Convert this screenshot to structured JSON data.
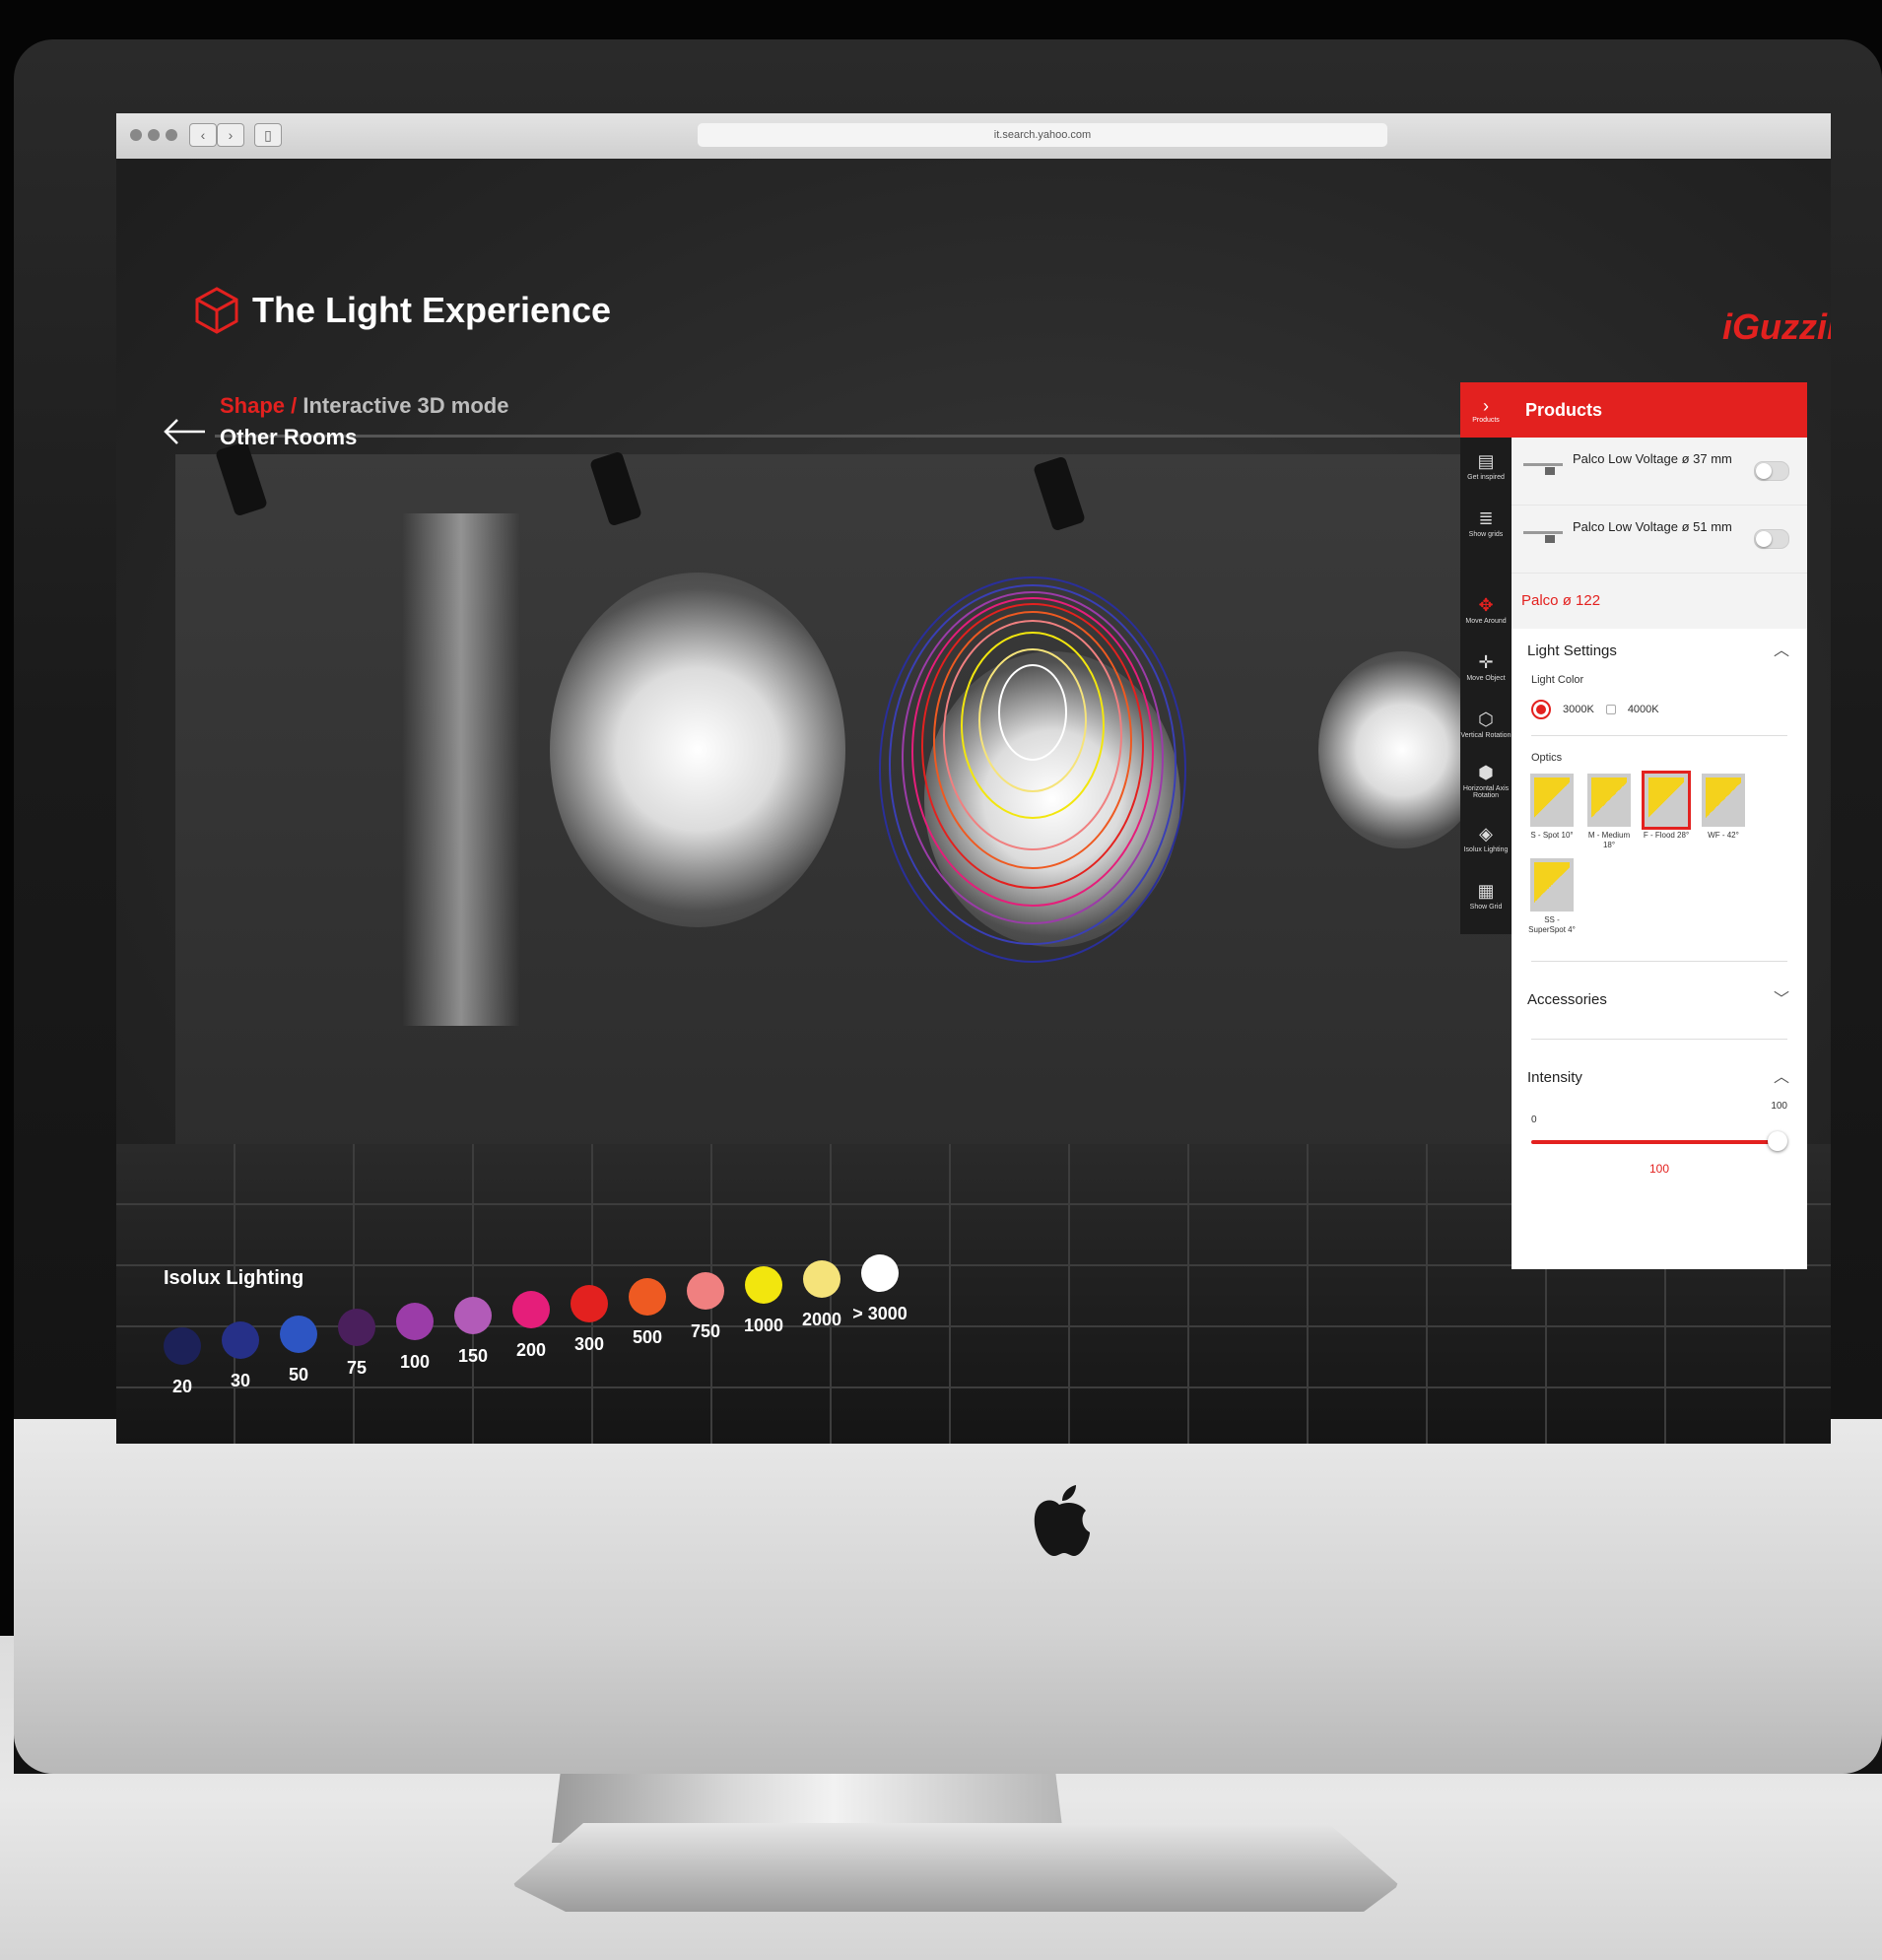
{
  "browser": {
    "url": "it.search.yahoo.com"
  },
  "header": {
    "title": "The Light Experience",
    "brand": "iGuzzini",
    "breadcrumb_section": "Shape /",
    "breadcrumb_mode": "Interactive 3D mode",
    "back_label": "Other Rooms"
  },
  "isolux": {
    "title": "Isolux Lighting",
    "legend": [
      {
        "label": "20",
        "color": "#1c2158"
      },
      {
        "label": "30",
        "color": "#263088"
      },
      {
        "label": "50",
        "color": "#2d55c3"
      },
      {
        "label": "75",
        "color": "#4a1f5c"
      },
      {
        "label": "100",
        "color": "#9b3ca8"
      },
      {
        "label": "150",
        "color": "#b25bb8"
      },
      {
        "label": "200",
        "color": "#e51e7a"
      },
      {
        "label": "300",
        "color": "#e3211f"
      },
      {
        "label": "500",
        "color": "#ee5a22"
      },
      {
        "label": "750",
        "color": "#f08080"
      },
      {
        "label": "1000",
        "color": "#f2e60e"
      },
      {
        "label": "2000",
        "color": "#f5e37a"
      },
      {
        "label": "> 3000",
        "color": "#ffffff"
      }
    ]
  },
  "rail": {
    "top_label": "Products",
    "items": [
      {
        "icon": "document-icon",
        "label": "Get inspired"
      },
      {
        "icon": "grid-list-icon",
        "label": "Show grids"
      },
      {
        "icon": "move-around-icon",
        "label": "Move Around"
      },
      {
        "icon": "move-object-icon",
        "label": "Move Object"
      },
      {
        "icon": "vertical-rotation-icon",
        "label": "Vertical Rotation"
      },
      {
        "icon": "horizontal-rotation-icon",
        "label": "Horizontal Axis Rotation"
      },
      {
        "icon": "isolux-icon",
        "label": "Isolux Lighting"
      },
      {
        "icon": "grid-icon",
        "label": "Show Grid"
      }
    ]
  },
  "panel": {
    "title": "Products",
    "products": [
      {
        "name": "Palco Low Voltage ø 37 mm"
      },
      {
        "name": "Palco Low Voltage ø 51 mm"
      }
    ],
    "selected_product": "Palco ø 122",
    "light_settings": {
      "title": "Light Settings",
      "color_label": "Light Color",
      "color_options": [
        "3000K",
        "4000K"
      ],
      "selected_color": "3000K",
      "optics_label": "Optics",
      "optics": [
        {
          "label": "S - Spot 10°"
        },
        {
          "label": "M - Medium 18°"
        },
        {
          "label": "F - Flood 28°"
        },
        {
          "label": "WF - 42°"
        },
        {
          "label": "SS - SuperSpot 4°"
        }
      ],
      "selected_optic": "F - Flood 28°"
    },
    "accessories_title": "Accessories",
    "intensity": {
      "title": "Intensity",
      "min": "0",
      "max": "100",
      "value": "100"
    }
  }
}
